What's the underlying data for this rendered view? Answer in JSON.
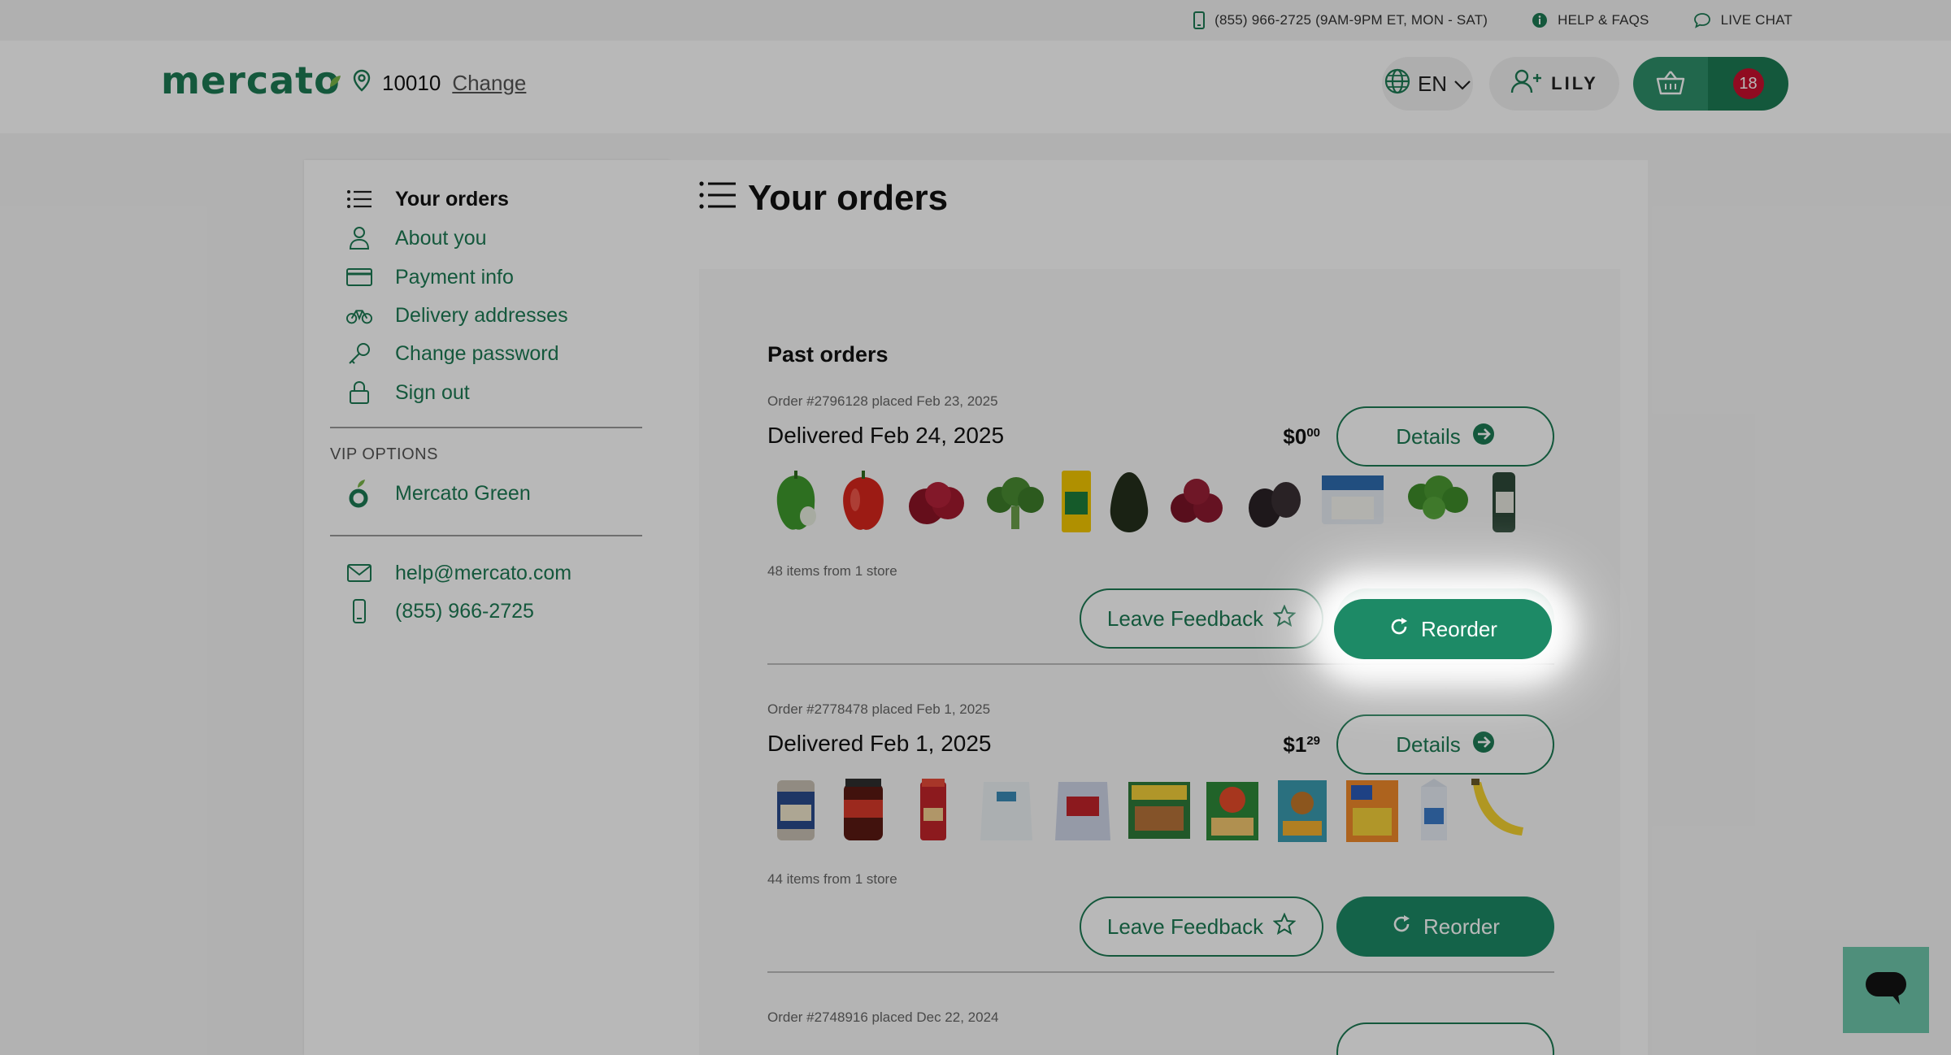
{
  "utility": {
    "phone": "(855) 966-2725 (9AM-9PM ET, MON - SAT)",
    "help": "HELP & FAQS",
    "chat": "LIVE CHAT"
  },
  "header": {
    "logo": "mercato",
    "zip": "10010",
    "change_label": "Change",
    "language": "EN",
    "user_name": "LILY",
    "cart_count": "18"
  },
  "sidebar": {
    "items": [
      {
        "label": "Your orders",
        "icon": "list-icon"
      },
      {
        "label": "About you",
        "icon": "person-icon"
      },
      {
        "label": "Payment info",
        "icon": "credit-card-icon"
      },
      {
        "label": "Delivery addresses",
        "icon": "bicycle-icon"
      },
      {
        "label": "Change password",
        "icon": "key-icon"
      },
      {
        "label": "Sign out",
        "icon": "lock-icon"
      }
    ],
    "vip_label": "VIP OPTIONS",
    "vip_item": "Mercato Green",
    "email": "help@mercato.com",
    "phone": "(855) 966-2725"
  },
  "main": {
    "title": "Your orders",
    "past_orders_title": "Past orders",
    "orders": [
      {
        "meta": "Order #2796128 placed Feb 23, 2025",
        "delivered": "Delivered Feb 24, 2025",
        "price_whole": "$0",
        "price_cents": "00",
        "details_label": "Details",
        "count": "48 items from 1 store",
        "feedback_label": "Leave Feedback",
        "reorder_label": "Reorder"
      },
      {
        "meta": "Order #2778478 placed Feb 1, 2025",
        "delivered": "Delivered Feb 1, 2025",
        "price_whole": "$1",
        "price_cents": "29",
        "details_label": "Details",
        "count": "44 items from 1 store",
        "feedback_label": "Leave Feedback",
        "reorder_label": "Reorder"
      },
      {
        "meta": "Order #2748916 placed Dec 22, 2024"
      }
    ]
  },
  "colors": {
    "brand_green": "#1d7a54",
    "reorder_green": "#1d8a66",
    "badge_red": "#c8102e"
  }
}
